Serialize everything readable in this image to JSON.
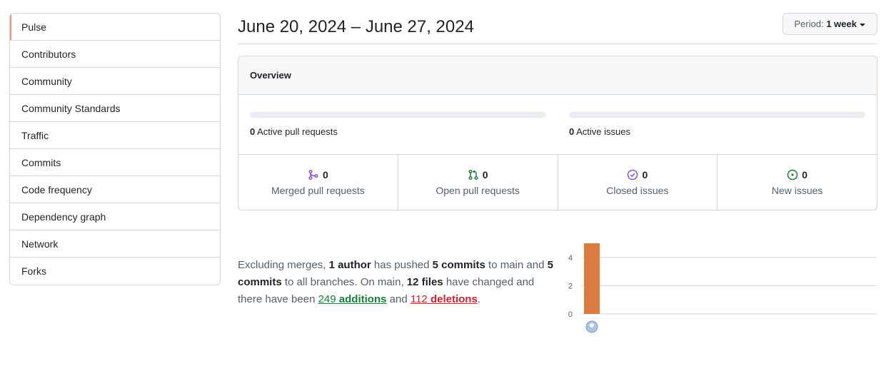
{
  "sidebar": {
    "items": [
      {
        "label": "Pulse",
        "selected": true
      },
      {
        "label": "Contributors"
      },
      {
        "label": "Community"
      },
      {
        "label": "Community Standards"
      },
      {
        "label": "Traffic"
      },
      {
        "label": "Commits"
      },
      {
        "label": "Code frequency"
      },
      {
        "label": "Dependency graph"
      },
      {
        "label": "Network"
      },
      {
        "label": "Forks"
      }
    ]
  },
  "header": {
    "date_range": "June 20, 2024 – June 27, 2024",
    "period_prefix": "Period:",
    "period_value": "1 week"
  },
  "overview": {
    "title": "Overview",
    "active_prs": {
      "count": "0",
      "label": "Active pull requests"
    },
    "active_issues": {
      "count": "0",
      "label": "Active issues"
    },
    "stats": [
      {
        "icon": "merged-pr-icon",
        "count": "0",
        "label": "Merged pull requests",
        "color": "#8250df"
      },
      {
        "icon": "open-pr-icon",
        "count": "0",
        "label": "Open pull requests",
        "color": "#1a7f37"
      },
      {
        "icon": "closed-issue-icon",
        "count": "0",
        "label": "Closed issues",
        "color": "#8250df"
      },
      {
        "icon": "open-issue-icon",
        "count": "0",
        "label": "New issues",
        "color": "#1a7f37"
      }
    ]
  },
  "summary": {
    "t1": "Excluding merges, ",
    "authors": "1 author",
    "t2": " has pushed ",
    "commits_main": "5 commits",
    "t3": " to main and ",
    "commits_all": "5 commits",
    "t4": " to all branches. On main, ",
    "files": "12 files",
    "t5": " have changed and there have been ",
    "additions_num": "249",
    "additions_word": "additions",
    "t6": " and ",
    "deletions_num": "112",
    "deletions_word": "deletions",
    "t7": "."
  },
  "chart_data": {
    "type": "bar",
    "categories": [
      "author-1"
    ],
    "values": [
      5
    ],
    "ylim": [
      0,
      5
    ],
    "yticks": [
      "0",
      "2",
      "4"
    ],
    "bar_color": "#db7c3f",
    "grid": true
  }
}
